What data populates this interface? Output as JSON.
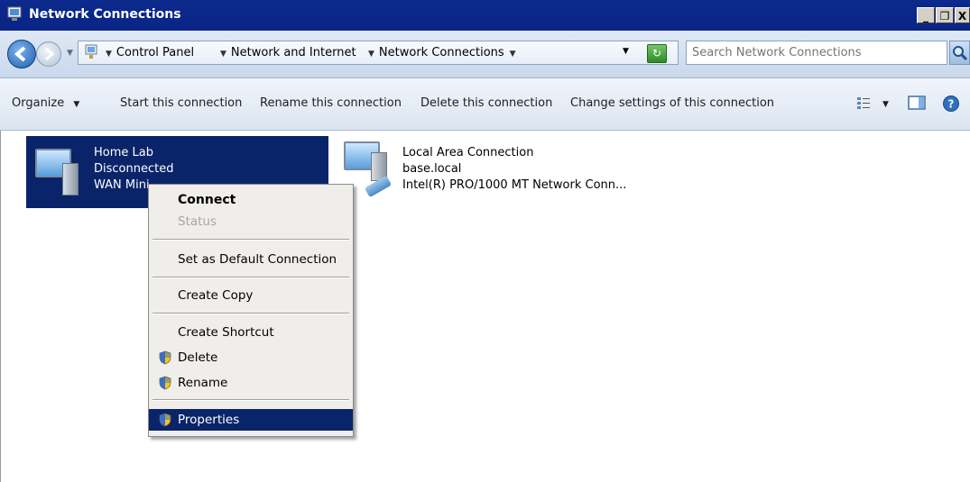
{
  "window": {
    "title": "Network Connections"
  },
  "address": {
    "crumbs": [
      "Control Panel",
      "Network and Internet",
      "Network Connections"
    ],
    "search_placeholder": "Search Network Connections"
  },
  "toolbar": {
    "organize": "Organize",
    "start": "Start this connection",
    "rename": "Rename this connection",
    "delete": "Delete this connection",
    "change": "Change settings of this connection"
  },
  "connections": [
    {
      "name": "Home Lab",
      "status": "Disconnected",
      "device": "WAN Mini"
    },
    {
      "name": "Local Area Connection",
      "status": "base.local",
      "device": "Intel(R) PRO/1000 MT Network Conn..."
    }
  ],
  "context_menu": {
    "connect": "Connect",
    "status": "Status",
    "set_default": "Set as Default Connection",
    "create_copy": "Create Copy",
    "create_shortcut": "Create Shortcut",
    "delete": "Delete",
    "rename": "Rename",
    "properties": "Properties"
  }
}
